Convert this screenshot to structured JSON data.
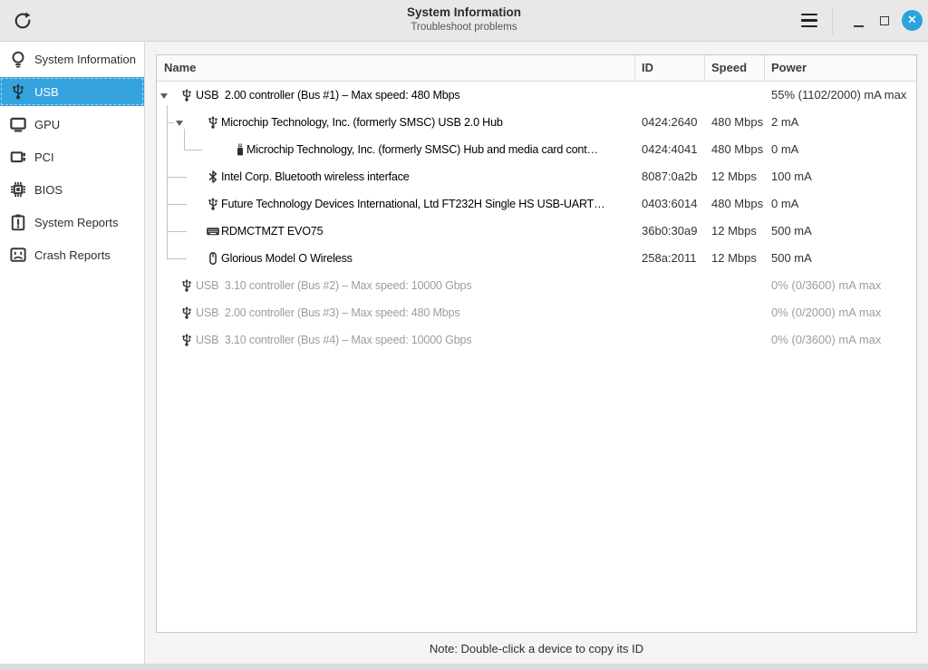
{
  "titlebar": {
    "title": "System Information",
    "subtitle": "Troubleshoot problems",
    "accent_color": "#2da3dc"
  },
  "window_controls": {
    "menu_icon": "hamburger",
    "minimize_icon": "minimize",
    "maximize_icon": "maximize",
    "close_icon": "close",
    "close_glyph": "×"
  },
  "sidebar": {
    "selected_color": "#35a3dd",
    "items": [
      {
        "label": "System Information",
        "icon": "lightbulb",
        "selected": false
      },
      {
        "label": "USB",
        "icon": "usb",
        "selected": true
      },
      {
        "label": "GPU",
        "icon": "monitor",
        "selected": false
      },
      {
        "label": "PCI",
        "icon": "pci-card",
        "selected": false
      },
      {
        "label": "BIOS",
        "icon": "chip",
        "selected": false
      },
      {
        "label": "System Reports",
        "icon": "clipboard-alert",
        "selected": false
      },
      {
        "label": "Crash Reports",
        "icon": "crash-screen",
        "selected": false
      }
    ]
  },
  "table": {
    "columns": [
      "Name",
      "ID",
      "Speed",
      "Power"
    ],
    "rows": [
      {
        "level": 0,
        "expander": true,
        "icon": "usb",
        "name": "USB  2.00 controller (Bus #1) – Max speed: 480 Mbps",
        "id": "",
        "speed": "",
        "power": "55% (1102/2000) mA max",
        "dimmed": false
      },
      {
        "level": 1,
        "expander": true,
        "icon": "usb",
        "name": "Microchip Technology, Inc. (formerly SMSC) USB 2.0 Hub",
        "id": "0424:2640",
        "speed": "480 Mbps",
        "power": "2 mA",
        "dimmed": false
      },
      {
        "level": 2,
        "expander": false,
        "icon": "flash-drive",
        "name": "Microchip Technology, Inc. (formerly SMSC) Hub and media card cont…",
        "id": "0424:4041",
        "speed": "480 Mbps",
        "power": "0 mA",
        "dimmed": false
      },
      {
        "level": 1,
        "expander": false,
        "icon": "bluetooth",
        "name": "Intel Corp. Bluetooth wireless interface",
        "id": "8087:0a2b",
        "speed": "12 Mbps",
        "power": "100 mA",
        "dimmed": false
      },
      {
        "level": 1,
        "expander": false,
        "icon": "usb",
        "name": "Future Technology Devices International, Ltd FT232H Single HS USB-UART…",
        "id": "0403:6014",
        "speed": "480 Mbps",
        "power": "0 mA",
        "dimmed": false
      },
      {
        "level": 1,
        "expander": false,
        "icon": "keyboard",
        "name": "RDMCTMZT EVO75",
        "id": "36b0:30a9",
        "speed": "12 Mbps",
        "power": "500 mA",
        "dimmed": false
      },
      {
        "level": 1,
        "expander": false,
        "icon": "mouse",
        "name": "Glorious Model O Wireless",
        "id": "258a:2011",
        "speed": "12 Mbps",
        "power": "500 mA",
        "dimmed": false
      },
      {
        "level": 0,
        "expander": false,
        "icon": "usb",
        "name": "USB  3.10 controller (Bus #2) – Max speed: 10000 Gbps",
        "id": "",
        "speed": "",
        "power": "0% (0/3600) mA max",
        "dimmed": true
      },
      {
        "level": 0,
        "expander": false,
        "icon": "usb",
        "name": "USB  2.00 controller (Bus #3) – Max speed: 480 Mbps",
        "id": "",
        "speed": "",
        "power": "0% (0/2000) mA max",
        "dimmed": true
      },
      {
        "level": 0,
        "expander": false,
        "icon": "usb",
        "name": "USB  3.10 controller (Bus #4) – Max speed: 10000 Gbps",
        "id": "",
        "speed": "",
        "power": "0% (0/3600) mA max",
        "dimmed": true
      }
    ],
    "note": "Note: Double-click a device to copy its ID"
  }
}
